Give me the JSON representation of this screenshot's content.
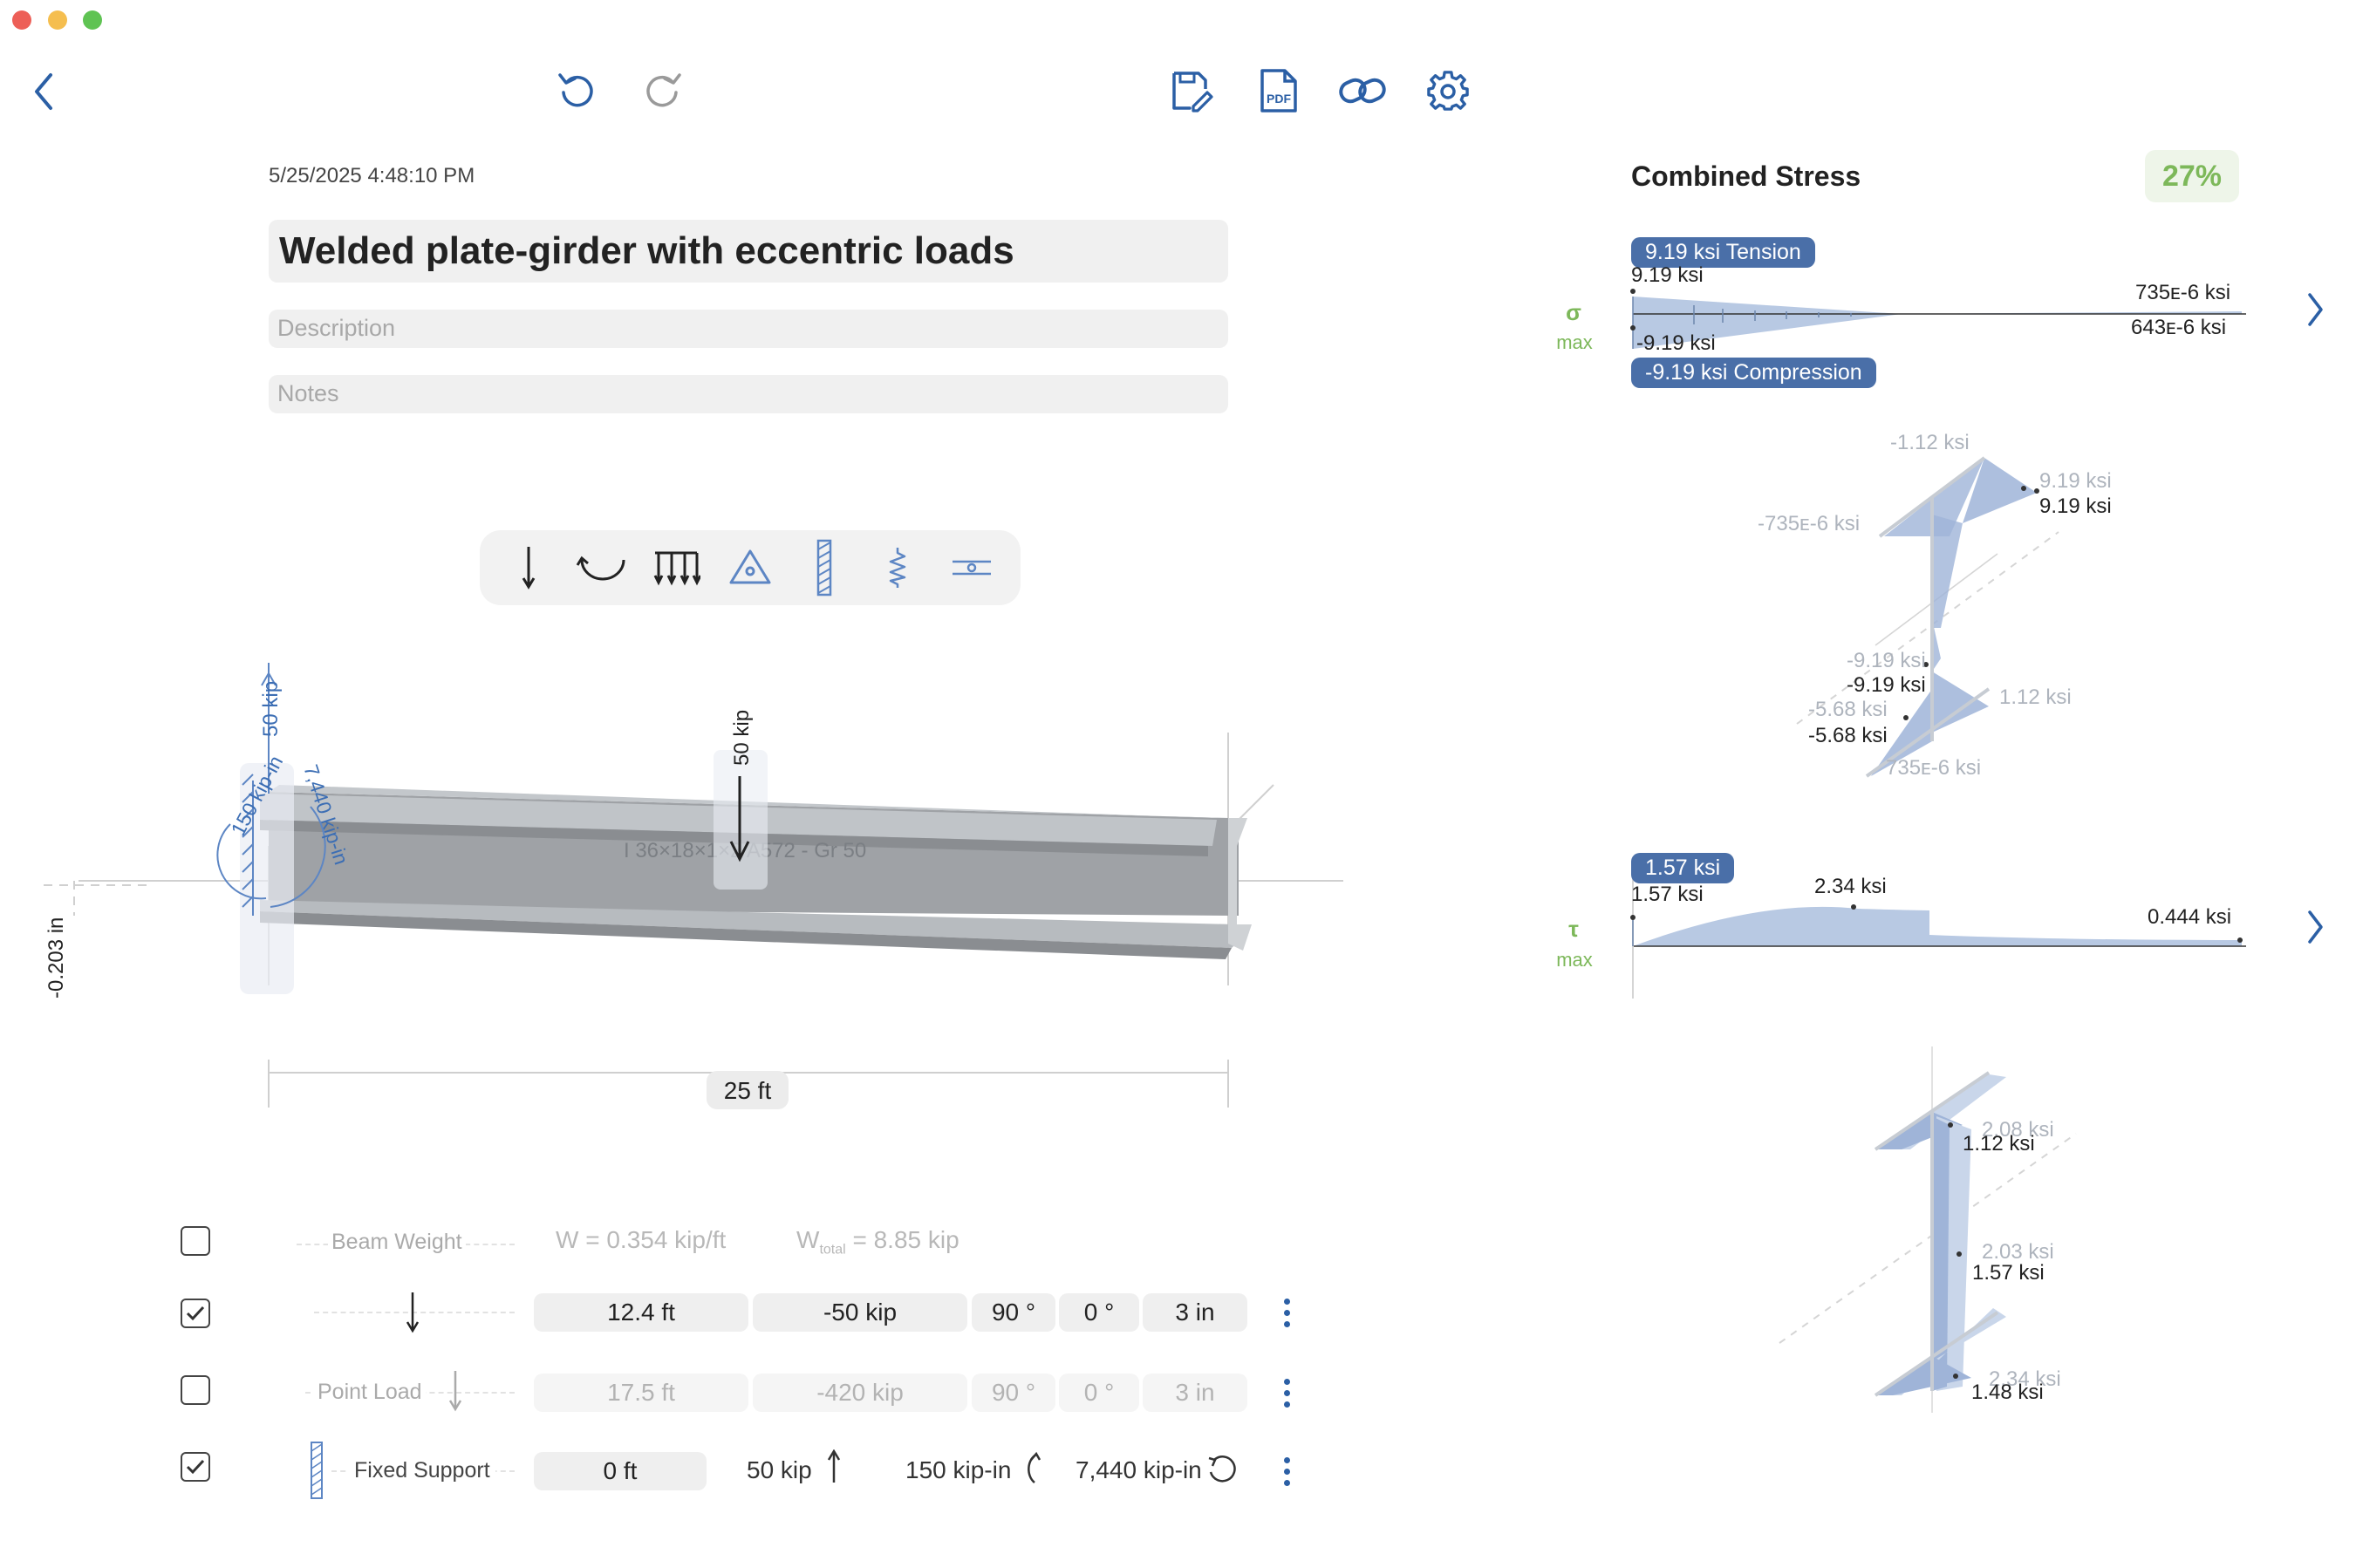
{
  "window": {
    "traffic_lights": {
      "close": "#ed5f57",
      "minimize": "#f5be4f",
      "zoom": "#5fc353"
    }
  },
  "toolbar": {
    "back_icon": "chevron-left-icon",
    "undo_icon": "undo-icon",
    "redo_icon": "redo-icon",
    "save_icon": "save-edit-icon",
    "pdf_label": "PDF",
    "link_icon": "link-icon",
    "settings_icon": "gear-icon"
  },
  "document": {
    "timestamp": "5/25/2025 4:48:10 PM",
    "title": "Welded plate-girder with eccentric loads",
    "description_placeholder": "Description",
    "notes_placeholder": "Notes"
  },
  "load_tools": [
    "point-load-icon",
    "moment-icon",
    "distributed-load-icon",
    "pin-support-icon",
    "fixed-support-icon",
    "spring-icon",
    "hinge-icon"
  ],
  "beam_view": {
    "section_label": "I 36×18×1×2 A572 - Gr 50",
    "span_label": "25 ft",
    "deflection_label": "-0.203 in",
    "support_reaction_force": "50 kip",
    "support_reaction_moment_1": "150 kip-in",
    "support_reaction_moment_2": "7,440 kip-in",
    "applied_load": "50 kip"
  },
  "loads_table": {
    "rows": [
      {
        "checked": false,
        "name": "Beam Weight",
        "w": "W  =  0.354 kip/ft",
        "w_total_prefix": "W",
        "w_total_sub": "total",
        "w_total_value": "=  8.85 kip"
      },
      {
        "checked": true,
        "icon": "point-load-icon",
        "position": "12.4 ft",
        "magnitude": "-50 kip",
        "angle1": "90 °",
        "angle2": "0 °",
        "offset": "3 in"
      },
      {
        "checked": false,
        "name": "Point Load",
        "icon": "point-load-icon",
        "position": "17.5 ft",
        "magnitude": "-420 kip",
        "angle1": "90 °",
        "angle2": "0 °",
        "offset": "3 in"
      },
      {
        "checked": true,
        "name": "Fixed Support",
        "icon": "fixed-support-icon",
        "position": "0 ft",
        "force": "50 kip",
        "moment1": "150 kip-in",
        "moment2": "7,440 kip-in"
      }
    ]
  },
  "stress_panel": {
    "title": "Combined Stress",
    "utilization": "27%",
    "utilization_color": "#7db85a",
    "sigma": {
      "symbol": "σ",
      "sub": "max",
      "tension_badge": "9.19 ksi Tension",
      "compression_badge": "-9.19 ksi Compression",
      "left_top": "9.19 ksi",
      "left_bottom": "-9.19 ksi",
      "right_top": "735ᴇ-6 ksi",
      "right_bottom": "643ᴇ-6 ksi",
      "section_labels": {
        "a": "-1.12 ksi",
        "b": "9.19 ksi",
        "c": "9.19 ksi",
        "d": "-735ᴇ-6 ksi",
        "e": "-9.19 ksi",
        "f": "-9.19 ksi",
        "g": "-5.68 ksi",
        "h": "-5.68 ksi",
        "i": "1.12 ksi",
        "j": "735ᴇ-6 ksi"
      }
    },
    "tau": {
      "symbol": "τ",
      "sub": "max",
      "badge": "1.57 ksi",
      "left": "1.57 ksi",
      "peak": "2.34 ksi",
      "right": "0.444 ksi",
      "section_labels": {
        "a": "2.08 ksi",
        "b": "1.12 ksi",
        "c": "2.03 ksi",
        "d": "1.57 ksi",
        "e": "2.34 ksi",
        "f": "1.48 ksi"
      }
    }
  }
}
